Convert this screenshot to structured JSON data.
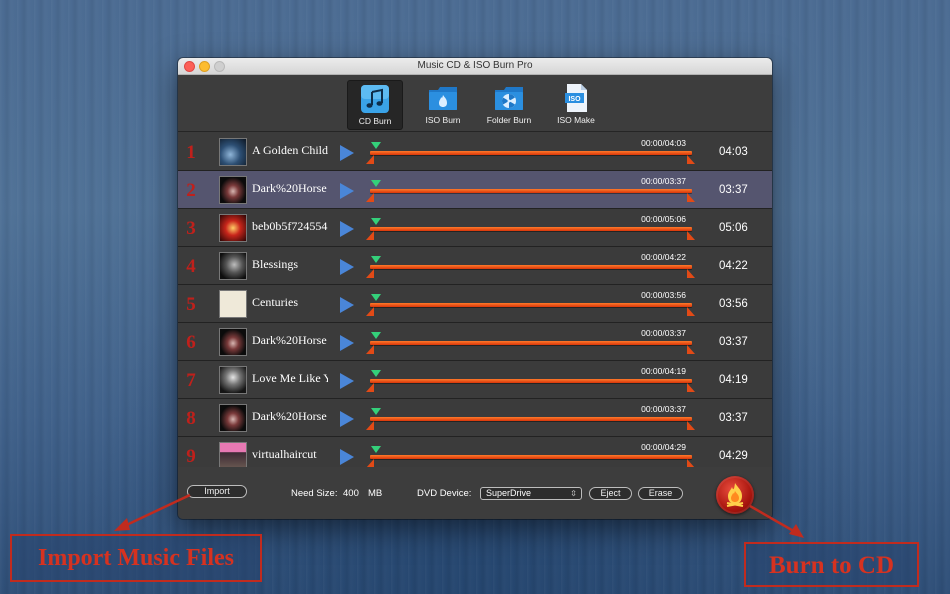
{
  "window": {
    "title": "Music CD & ISO Burn Pro"
  },
  "toolbar": {
    "items": [
      {
        "label": "CD Burn",
        "icon": "music-note-icon",
        "active": true
      },
      {
        "label": "ISO Burn",
        "icon": "flame-folder-icon",
        "active": false
      },
      {
        "label": "Folder Burn",
        "icon": "disc-folder-icon",
        "active": false
      },
      {
        "label": "ISO Make",
        "icon": "iso-file-icon",
        "active": false
      }
    ]
  },
  "tracks": [
    {
      "number": "1",
      "name": "A Golden Child",
      "time": "00:00/04:03",
      "duration": "04:03",
      "progress": 0,
      "selected": false
    },
    {
      "number": "2",
      "name": "Dark%20Horse",
      "time": "00:00/03:37",
      "duration": "03:37",
      "progress": 0,
      "selected": true
    },
    {
      "number": "3",
      "name": "beb0b5f724554",
      "time": "00:00/05:06",
      "duration": "05:06",
      "progress": 0,
      "selected": false
    },
    {
      "number": "4",
      "name": "Blessings",
      "time": "00:00/04:22",
      "duration": "04:22",
      "progress": 0,
      "selected": false
    },
    {
      "number": "5",
      "name": "Centuries",
      "time": "00:00/03:56",
      "duration": "03:56",
      "progress": 0,
      "selected": false
    },
    {
      "number": "6",
      "name": "Dark%20Horse",
      "time": "00:00/03:37",
      "duration": "03:37",
      "progress": 0,
      "selected": false
    },
    {
      "number": "7",
      "name": "Love Me Like Y",
      "time": "00:00/04:19",
      "duration": "04:19",
      "progress": 0,
      "selected": false
    },
    {
      "number": "8",
      "name": "Dark%20Horse",
      "time": "00:00/03:37",
      "duration": "03:37",
      "progress": 0,
      "selected": false
    },
    {
      "number": "9",
      "name": "virtualhaircut",
      "time": "00:00/04:29",
      "duration": "04:29",
      "progress": 0,
      "selected": false
    }
  ],
  "bottom": {
    "import_label": "Import",
    "need_size_label": "Need Size:",
    "need_size_value": "400",
    "need_size_unit": "MB",
    "dvd_device_label": "DVD Device:",
    "dvd_device_value": "SuperDrive",
    "eject_label": "Eject",
    "erase_label": "Erase",
    "burn_icon": "flame-burn-icon"
  },
  "callouts": {
    "import": "Import Music Files",
    "burn": "Burn to CD"
  },
  "colors": {
    "accent_red": "#c0201b",
    "bar_orange": "#ff7a2a",
    "play_blue": "#4a86d8",
    "marker_green": "#34d07a",
    "selected_row": "#55556f"
  }
}
